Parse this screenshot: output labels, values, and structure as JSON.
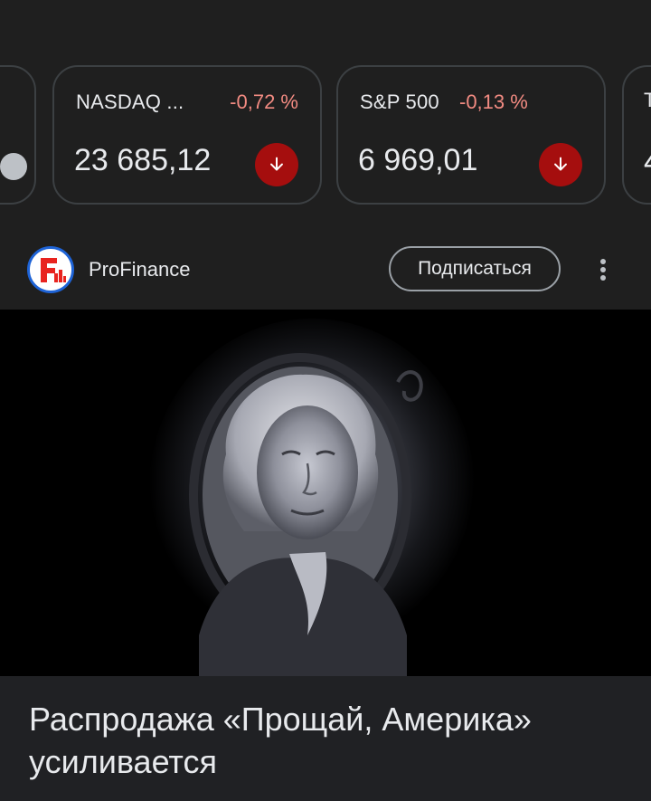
{
  "tickers": [
    {
      "name": "NASDAQ ...",
      "change": "-0,72 %",
      "value": "23 685,12",
      "direction": "down"
    },
    {
      "name": "S&P 500",
      "change": "-0,13 %",
      "value": "6 969,01",
      "direction": "down"
    }
  ],
  "partial_right_card": {
    "top_letter": "T",
    "bottom_letter": "4"
  },
  "publisher": {
    "name": "ProFinance",
    "subscribe_label": "Подписаться",
    "logo_icon": "profinance-logo-icon"
  },
  "article": {
    "image_icon": "george-washington-portrait-image",
    "headline": "Распродажа «Прощай, Америка» усиливается"
  },
  "colors": {
    "background": "#202124",
    "negative_change": "#f28b82",
    "down_arrow_bg": "#a50e0e",
    "card_border": "#3c4043"
  }
}
